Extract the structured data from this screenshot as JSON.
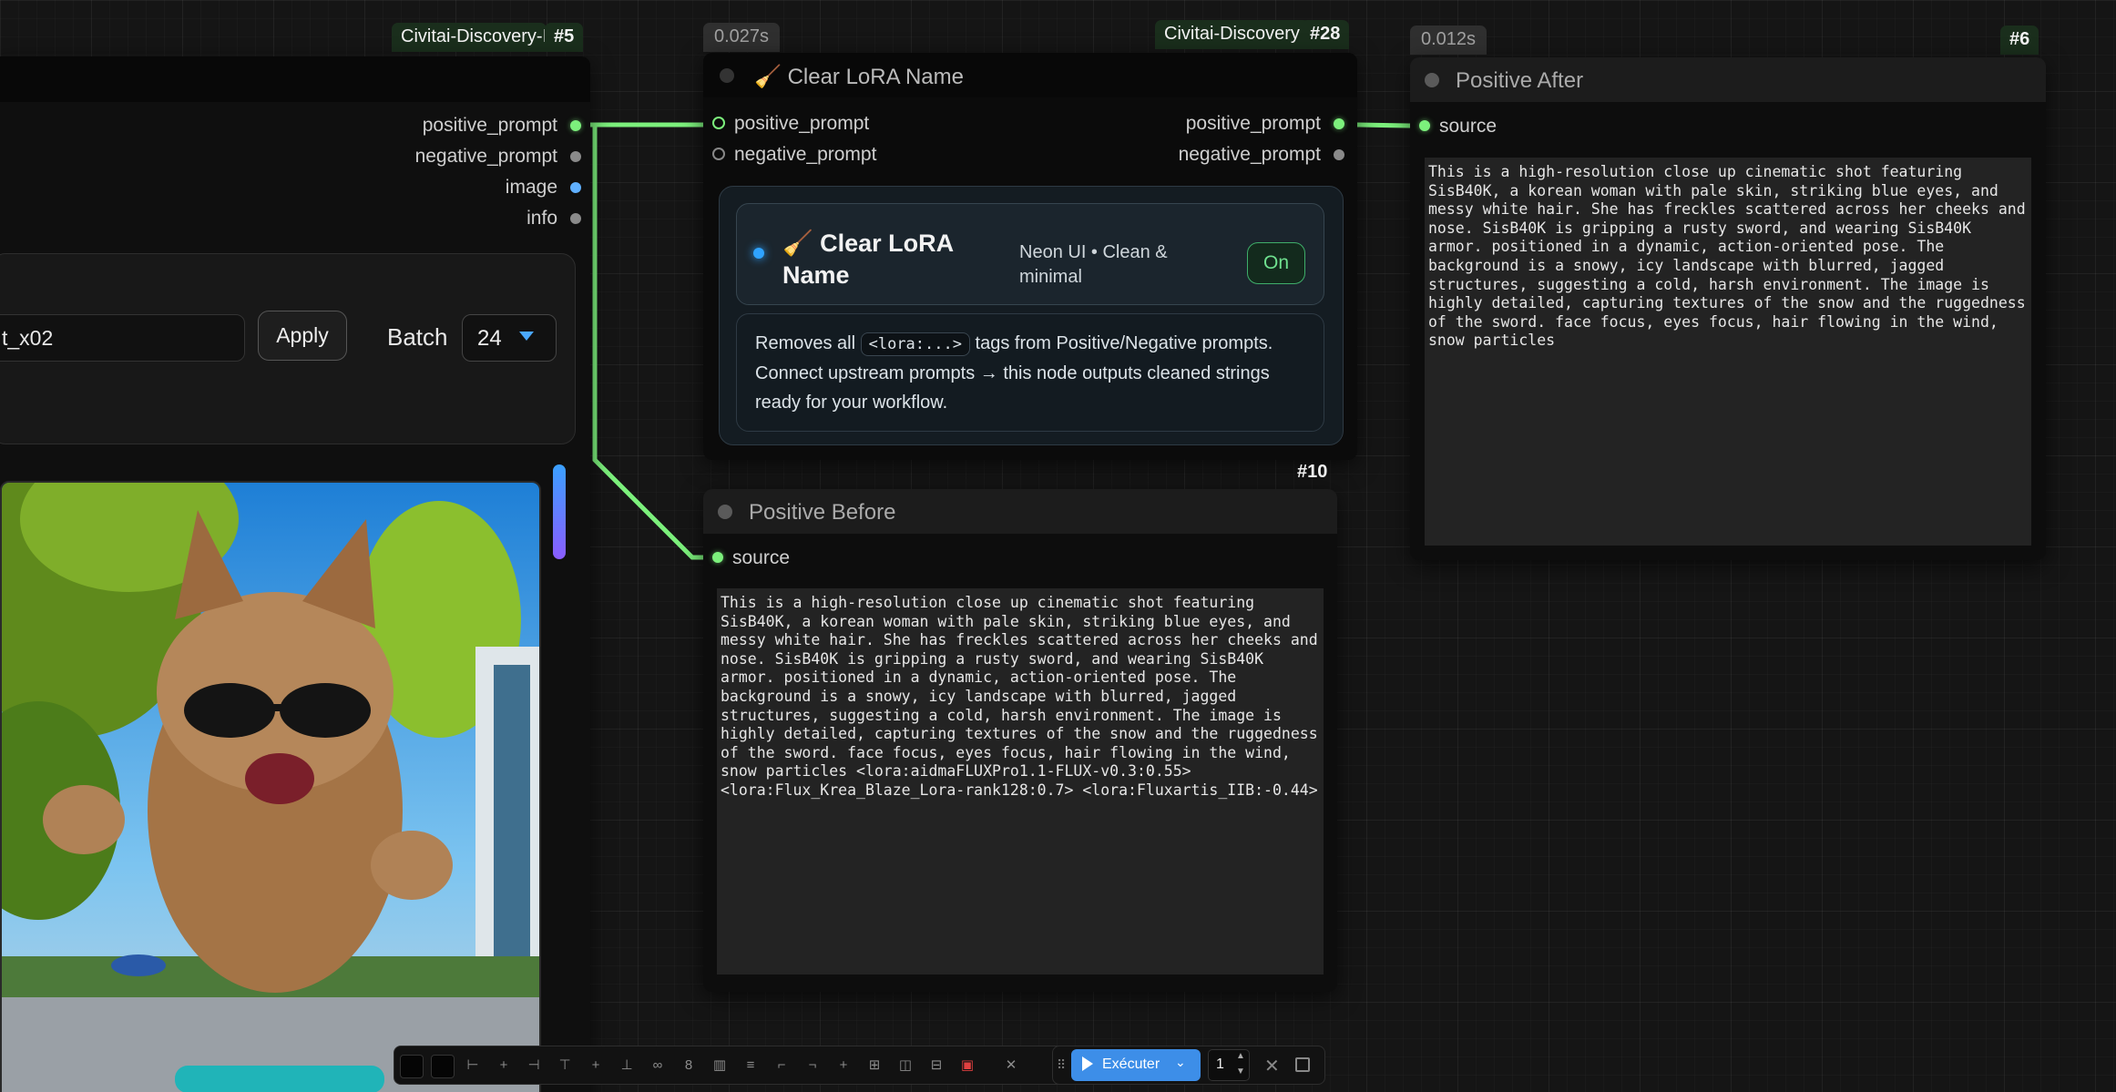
{
  "node5": {
    "id": "#5",
    "label": "Civitai-Discovery-I",
    "outputs": [
      "positive_prompt",
      "negative_prompt",
      "image",
      "info"
    ],
    "model_input_value": "t_x02",
    "apply_label": "Apply",
    "batch_label": "Batch",
    "batch_value": "24"
  },
  "node28": {
    "time": "0.027s",
    "label": "Civitai-Discovery",
    "id": "#28",
    "title": "Clear LoRA Name",
    "emoji": "🧹",
    "inputs": [
      "positive_prompt",
      "negative_prompt"
    ],
    "outputs": [
      "positive_prompt",
      "negative_prompt"
    ],
    "card_title": "Clear LoRA Name",
    "card_subtitle": "Neon UI • Clean & minimal",
    "toggle": "On",
    "desc_prefix": "Removes all",
    "desc_code": "<lora:...>",
    "desc_suffix": "tags from Positive/Negative prompts. Connect upstream prompts → this node outputs cleaned strings ready for your workflow."
  },
  "node10": {
    "id": "#10",
    "title": "Positive Before",
    "input": "source",
    "text": "This is a high-resolution close up cinematic shot featuring SisB40K, a korean woman with pale skin, striking blue eyes, and messy white hair. She has freckles scattered across her cheeks and nose. SisB40K is gripping a rusty sword, and wearing SisB40K armor. positioned in a dynamic, action-oriented pose. The background is a snowy, icy landscape with blurred, jagged structures, suggesting a cold, harsh environment. The image is highly detailed, capturing textures of the snow and the ruggedness of the sword. face focus, eyes focus, hair flowing in the wind, snow particles <lora:aidmaFLUXPro1.1-FLUX-v0.3:0.55> <lora:Flux_Krea_Blaze_Lora-rank128:0.7> <lora:Fluxartis_IIB:-0.44>"
  },
  "node6": {
    "time": "0.012s",
    "id": "#6",
    "title": "Positive After",
    "input": "source",
    "text": "This is a high-resolution close up cinematic shot featuring SisB40K, a korean woman with pale skin, striking blue eyes, and messy white hair. She has freckles scattered across her cheeks and nose. SisB40K is gripping a rusty sword, and wearing SisB40K armor. positioned in a dynamic, action-oriented pose. The background is a snowy, icy landscape with blurred, jagged structures, suggesting a cold, harsh environment. The image is highly detailed, capturing textures of the snow and the ruggedness of the sword. face focus, eyes focus, hair flowing in the wind, snow particles"
  },
  "runbar": {
    "run_label": "Exécuter",
    "queue_count": "1"
  },
  "colors": {
    "link_green": "#7cf07c",
    "node_bg": "#0d0d0d",
    "badge_green": "#1a2e1c",
    "run_blue": "#3d8ee8"
  }
}
